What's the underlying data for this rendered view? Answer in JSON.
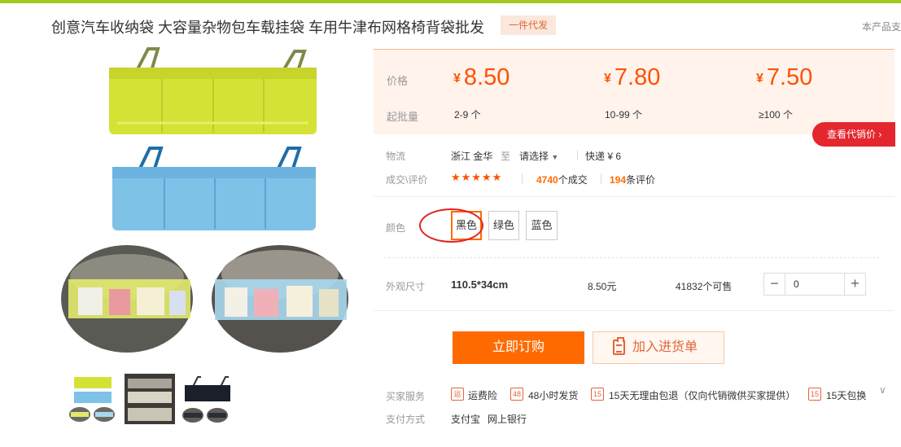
{
  "header": {
    "title": "创意汽车收纳袋 大容量杂物包车载挂袋 车用牛津布网格椅背袋批发",
    "tag": "一件代发",
    "right_link": "本产品支"
  },
  "price": {
    "price_label": "价格",
    "moq_label": "起批量",
    "currency": "¥",
    "tiers": [
      {
        "price": "8.50",
        "qty": "2-9 个"
      },
      {
        "price": "7.80",
        "qty": "10-99 个"
      },
      {
        "price": "7.50",
        "qty": "≥100 个"
      }
    ],
    "agent_button": "查看代销价"
  },
  "logistics": {
    "label": "物流",
    "origin": "浙江 金华",
    "to": "至",
    "select": "请选择",
    "express": "快递 ¥ 6"
  },
  "deals": {
    "label": "成交\\评价",
    "stars": "★★★★★",
    "deal_count": "4740",
    "deal_suffix": "个成交",
    "review_count": "194",
    "review_suffix": "条评价"
  },
  "color": {
    "label": "颜色",
    "options": [
      "黑色",
      "绿色",
      "蓝色"
    ],
    "selected": "黑色"
  },
  "size": {
    "label": "外观尺寸",
    "name": "110.5*34cm",
    "price": "8.50元",
    "stock": "41832个可售",
    "quantity": "0",
    "minus": "−",
    "plus": "+"
  },
  "actions": {
    "buy": "立即订购",
    "cart": "加入进货单"
  },
  "services": {
    "label": "买家服务",
    "items": [
      {
        "icon": "运",
        "text": "运费险"
      },
      {
        "icon": "48",
        "text": "48小时发货"
      },
      {
        "icon": "15",
        "text": "15天无理由包退（仅向代销微供买家提供）"
      },
      {
        "icon": "15",
        "text": "15天包换"
      }
    ]
  },
  "payment": {
    "label": "支付方式",
    "methods": [
      "支付宝",
      "网上银行"
    ]
  },
  "colors": {
    "accent": "#ff6a00",
    "price": "#ff5000",
    "agent_red": "#e4262f",
    "topbar": "#a0c81e",
    "bag_green": "#d4e236",
    "bag_blue": "#7ec2e8"
  }
}
